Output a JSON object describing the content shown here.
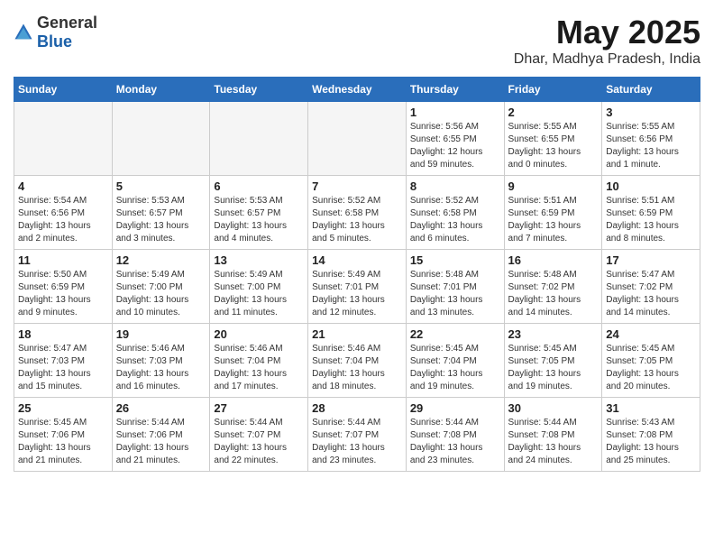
{
  "logo": {
    "general": "General",
    "blue": "Blue"
  },
  "header": {
    "month": "May 2025",
    "location": "Dhar, Madhya Pradesh, India"
  },
  "weekdays": [
    "Sunday",
    "Monday",
    "Tuesday",
    "Wednesday",
    "Thursday",
    "Friday",
    "Saturday"
  ],
  "weeks": [
    [
      {
        "day": "",
        "info": ""
      },
      {
        "day": "",
        "info": ""
      },
      {
        "day": "",
        "info": ""
      },
      {
        "day": "",
        "info": ""
      },
      {
        "day": "1",
        "info": "Sunrise: 5:56 AM\nSunset: 6:55 PM\nDaylight: 12 hours\nand 59 minutes."
      },
      {
        "day": "2",
        "info": "Sunrise: 5:55 AM\nSunset: 6:55 PM\nDaylight: 13 hours\nand 0 minutes."
      },
      {
        "day": "3",
        "info": "Sunrise: 5:55 AM\nSunset: 6:56 PM\nDaylight: 13 hours\nand 1 minute."
      }
    ],
    [
      {
        "day": "4",
        "info": "Sunrise: 5:54 AM\nSunset: 6:56 PM\nDaylight: 13 hours\nand 2 minutes."
      },
      {
        "day": "5",
        "info": "Sunrise: 5:53 AM\nSunset: 6:57 PM\nDaylight: 13 hours\nand 3 minutes."
      },
      {
        "day": "6",
        "info": "Sunrise: 5:53 AM\nSunset: 6:57 PM\nDaylight: 13 hours\nand 4 minutes."
      },
      {
        "day": "7",
        "info": "Sunrise: 5:52 AM\nSunset: 6:58 PM\nDaylight: 13 hours\nand 5 minutes."
      },
      {
        "day": "8",
        "info": "Sunrise: 5:52 AM\nSunset: 6:58 PM\nDaylight: 13 hours\nand 6 minutes."
      },
      {
        "day": "9",
        "info": "Sunrise: 5:51 AM\nSunset: 6:59 PM\nDaylight: 13 hours\nand 7 minutes."
      },
      {
        "day": "10",
        "info": "Sunrise: 5:51 AM\nSunset: 6:59 PM\nDaylight: 13 hours\nand 8 minutes."
      }
    ],
    [
      {
        "day": "11",
        "info": "Sunrise: 5:50 AM\nSunset: 6:59 PM\nDaylight: 13 hours\nand 9 minutes."
      },
      {
        "day": "12",
        "info": "Sunrise: 5:49 AM\nSunset: 7:00 PM\nDaylight: 13 hours\nand 10 minutes."
      },
      {
        "day": "13",
        "info": "Sunrise: 5:49 AM\nSunset: 7:00 PM\nDaylight: 13 hours\nand 11 minutes."
      },
      {
        "day": "14",
        "info": "Sunrise: 5:49 AM\nSunset: 7:01 PM\nDaylight: 13 hours\nand 12 minutes."
      },
      {
        "day": "15",
        "info": "Sunrise: 5:48 AM\nSunset: 7:01 PM\nDaylight: 13 hours\nand 13 minutes."
      },
      {
        "day": "16",
        "info": "Sunrise: 5:48 AM\nSunset: 7:02 PM\nDaylight: 13 hours\nand 14 minutes."
      },
      {
        "day": "17",
        "info": "Sunrise: 5:47 AM\nSunset: 7:02 PM\nDaylight: 13 hours\nand 14 minutes."
      }
    ],
    [
      {
        "day": "18",
        "info": "Sunrise: 5:47 AM\nSunset: 7:03 PM\nDaylight: 13 hours\nand 15 minutes."
      },
      {
        "day": "19",
        "info": "Sunrise: 5:46 AM\nSunset: 7:03 PM\nDaylight: 13 hours\nand 16 minutes."
      },
      {
        "day": "20",
        "info": "Sunrise: 5:46 AM\nSunset: 7:04 PM\nDaylight: 13 hours\nand 17 minutes."
      },
      {
        "day": "21",
        "info": "Sunrise: 5:46 AM\nSunset: 7:04 PM\nDaylight: 13 hours\nand 18 minutes."
      },
      {
        "day": "22",
        "info": "Sunrise: 5:45 AM\nSunset: 7:04 PM\nDaylight: 13 hours\nand 19 minutes."
      },
      {
        "day": "23",
        "info": "Sunrise: 5:45 AM\nSunset: 7:05 PM\nDaylight: 13 hours\nand 19 minutes."
      },
      {
        "day": "24",
        "info": "Sunrise: 5:45 AM\nSunset: 7:05 PM\nDaylight: 13 hours\nand 20 minutes."
      }
    ],
    [
      {
        "day": "25",
        "info": "Sunrise: 5:45 AM\nSunset: 7:06 PM\nDaylight: 13 hours\nand 21 minutes."
      },
      {
        "day": "26",
        "info": "Sunrise: 5:44 AM\nSunset: 7:06 PM\nDaylight: 13 hours\nand 21 minutes."
      },
      {
        "day": "27",
        "info": "Sunrise: 5:44 AM\nSunset: 7:07 PM\nDaylight: 13 hours\nand 22 minutes."
      },
      {
        "day": "28",
        "info": "Sunrise: 5:44 AM\nSunset: 7:07 PM\nDaylight: 13 hours\nand 23 minutes."
      },
      {
        "day": "29",
        "info": "Sunrise: 5:44 AM\nSunset: 7:08 PM\nDaylight: 13 hours\nand 23 minutes."
      },
      {
        "day": "30",
        "info": "Sunrise: 5:44 AM\nSunset: 7:08 PM\nDaylight: 13 hours\nand 24 minutes."
      },
      {
        "day": "31",
        "info": "Sunrise: 5:43 AM\nSunset: 7:08 PM\nDaylight: 13 hours\nand 25 minutes."
      }
    ]
  ]
}
